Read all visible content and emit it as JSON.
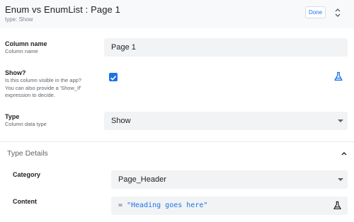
{
  "header": {
    "title": "Enum vs EnumList : Page 1",
    "subtitle": "type: Show",
    "done_label": "Done"
  },
  "column_name": {
    "label": "Column name",
    "sublabel": "Column name",
    "value": "Page 1"
  },
  "show": {
    "label": "Show?",
    "sublabel_lines": [
      "Is this column visible in the app?",
      "You can also provide a 'Show_If'",
      "expression to decide."
    ],
    "checked": true
  },
  "type": {
    "label": "Type",
    "sublabel": "Column data type",
    "value": "Show"
  },
  "type_details": {
    "title": "Type Details",
    "category": {
      "label": "Category",
      "value": "Page_Header"
    },
    "content": {
      "label": "Content",
      "operator": "=",
      "value": "\"Heading goes here\""
    }
  },
  "colors": {
    "accent": "#1a73e8",
    "field_bg": "#f1f3f4"
  }
}
